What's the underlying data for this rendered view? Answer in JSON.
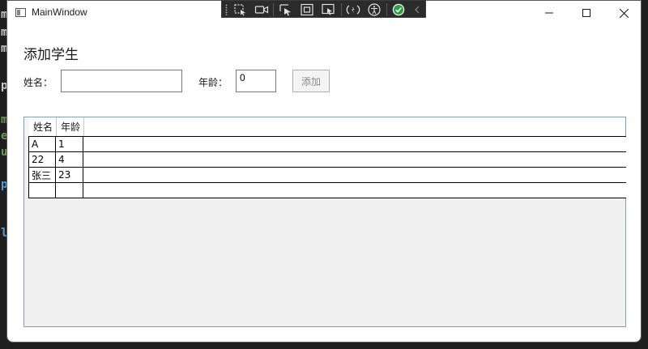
{
  "window": {
    "title": "MainWindow"
  },
  "form": {
    "heading": "添加学生",
    "name_label": "姓名：",
    "name_value": "",
    "age_label": "年龄：",
    "age_value": "0",
    "add_button": "添加"
  },
  "grid": {
    "columns": [
      "姓名",
      "年龄"
    ],
    "rows": [
      {
        "name": "A",
        "age": "1"
      },
      {
        "name": "22",
        "age": "4"
      },
      {
        "name": "张三",
        "age": "23"
      },
      {
        "name": "",
        "age": ""
      }
    ]
  },
  "debug_toolbar": {
    "icons": [
      "select-element-icon",
      "video-icon",
      "pointer-select-icon",
      "frame-icon",
      "display-layout-icon",
      "hot-reload-icon",
      "accessibility-icon",
      "check-icon",
      "collapse-chevron-icon"
    ]
  },
  "colors": {
    "grid_border": "#7e9fc0",
    "check_green": "#2ea043"
  }
}
